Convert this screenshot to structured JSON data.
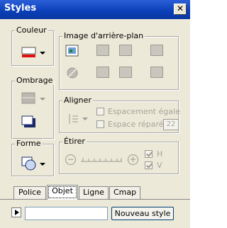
{
  "window": {
    "title": "Styles",
    "close_label": "✕"
  },
  "groups": {
    "couleur": "Couleur",
    "ombrage": "Ombrage",
    "forme": "Forme",
    "image_arriere_plan": "Image d'arrière-plan",
    "aligner": "Aligner",
    "etirer": "Étirer"
  },
  "aligner": {
    "espacement_egale": "Espacement égale",
    "espace_reparee": "Espace réparée",
    "espace_value": "22"
  },
  "etirer": {
    "h_label": "H",
    "v_label": "V",
    "h_checked": true,
    "v_checked": true,
    "minus": "−",
    "plus": "+"
  },
  "tabs": [
    "Police",
    "Objet",
    "Ligne",
    "Cmap"
  ],
  "active_tab": "Objet",
  "footer": {
    "style_name_value": "",
    "new_style_label": "Nouveau style"
  },
  "colors": {
    "titlebar": "#0a3fb7",
    "panel": "#ece9d8",
    "disabled": "#a6a49b"
  }
}
